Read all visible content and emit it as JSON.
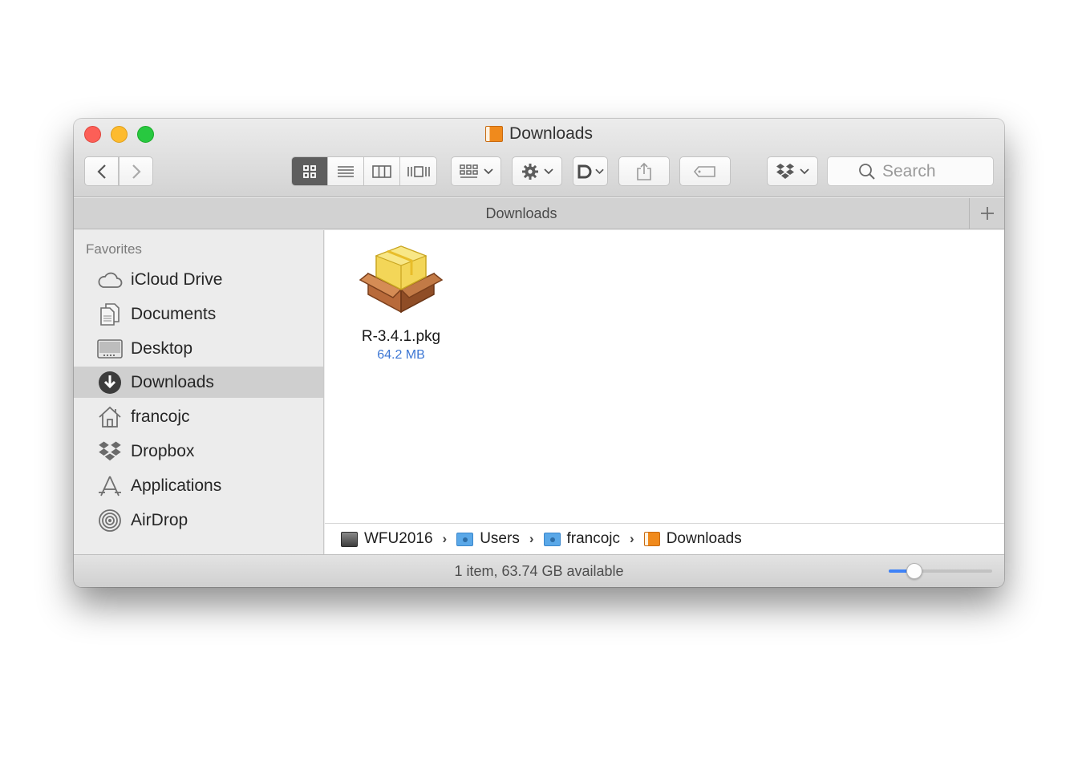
{
  "window": {
    "title": "Downloads",
    "tab_title": "Downloads"
  },
  "toolbar": {
    "back_icon": "chevron-left-icon",
    "forward_icon": "chevron-right-icon",
    "view_modes": [
      "icon-view",
      "list-view",
      "column-view",
      "coverflow-view"
    ],
    "active_view": "icon-view",
    "search_placeholder": "Search"
  },
  "sidebar": {
    "header": "Favorites",
    "items": [
      {
        "label": "iCloud Drive",
        "icon": "cloud-icon"
      },
      {
        "label": "Documents",
        "icon": "documents-icon"
      },
      {
        "label": "Desktop",
        "icon": "desktop-icon"
      },
      {
        "label": "Downloads",
        "icon": "downloads-icon",
        "selected": true
      },
      {
        "label": "francojc",
        "icon": "home-icon"
      },
      {
        "label": "Dropbox",
        "icon": "dropbox-icon"
      },
      {
        "label": "Applications",
        "icon": "applications-icon"
      },
      {
        "label": "AirDrop",
        "icon": "airdrop-icon"
      }
    ]
  },
  "files": [
    {
      "name": "R-3.4.1.pkg",
      "size": "64.2 MB",
      "icon": "package-icon"
    }
  ],
  "pathbar": {
    "crumbs": [
      "WFU2016",
      "Users",
      "francojc",
      "Downloads"
    ]
  },
  "status": {
    "text": "1 item, 63.74 GB available",
    "icon_size_slider": 0.25
  },
  "colors": {
    "selection": "#cfcfcf",
    "accent": "#3e82f7",
    "file_size": "#3d77d4",
    "close": "#fc5f57",
    "minimize": "#fdbb2e",
    "maximize": "#28c840"
  }
}
